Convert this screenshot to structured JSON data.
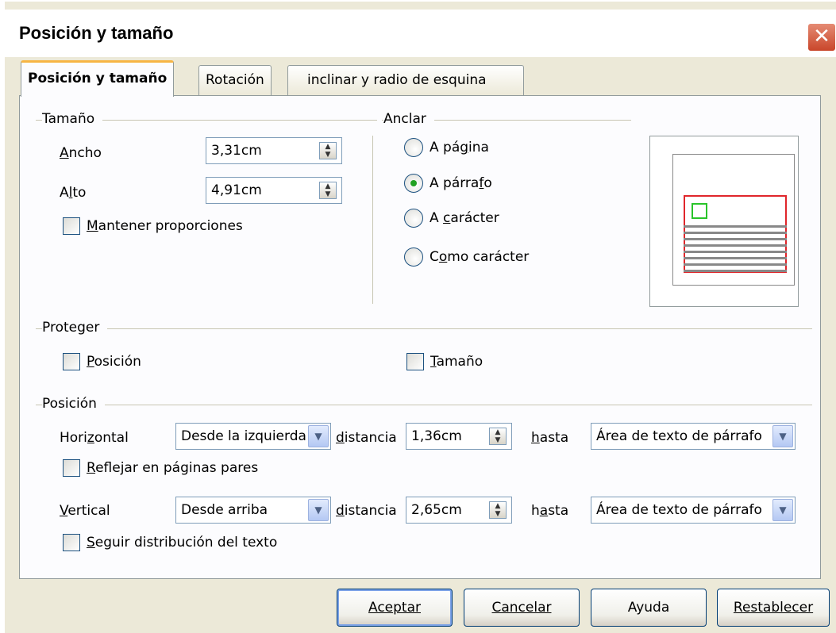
{
  "window": {
    "title": "Posición y tamaño"
  },
  "tabs": [
    {
      "label": "Posición y tamaño"
    },
    {
      "label": "Rotación"
    },
    {
      "label": "inclinar y radio de esquina"
    }
  ],
  "size": {
    "group_label": "Tamaño",
    "width_label": "Ancho",
    "width_value": "3,31cm",
    "height_label": "Alto",
    "height_value": "4,91cm",
    "keep_ratio_label": "Mantener proporciones",
    "keep_ratio_checked": false
  },
  "anchor": {
    "group_label": "Anclar",
    "options": [
      {
        "label": "A página",
        "selected": false
      },
      {
        "label": "A párrafo",
        "selected": true
      },
      {
        "label": "A carácter",
        "selected": false
      },
      {
        "label": "Como carácter",
        "selected": false
      }
    ]
  },
  "protect": {
    "group_label": "Proteger",
    "position_label": "Posición",
    "size_label": "Tamaño",
    "position_checked": false,
    "size_checked": false
  },
  "position": {
    "group_label": "Posición",
    "horizontal_label": "Horizontal",
    "horizontal_value": "Desde la izquierda",
    "distance_label": "distancia",
    "horizontal_distance": "1,36cm",
    "to_label": "hasta",
    "horizontal_to": "Área de texto de párrafo",
    "mirror_label": "Reflejar en páginas pares",
    "vertical_label": "Vertical",
    "vertical_value": "Desde arriba",
    "vertical_distance": "2,65cm",
    "vertical_to": "Área de texto de párrafo",
    "follow_flow_label": "Seguir distribución del texto"
  },
  "buttons": {
    "ok": "Aceptar",
    "cancel": "Cancelar",
    "help": "Ayuda",
    "reset": "Restablecer"
  },
  "colors": {
    "tab_highlight": "#f7b544",
    "preview_frame": "#e0262b",
    "preview_anchor": "#29c42a",
    "radio_dot": "#21a121"
  }
}
